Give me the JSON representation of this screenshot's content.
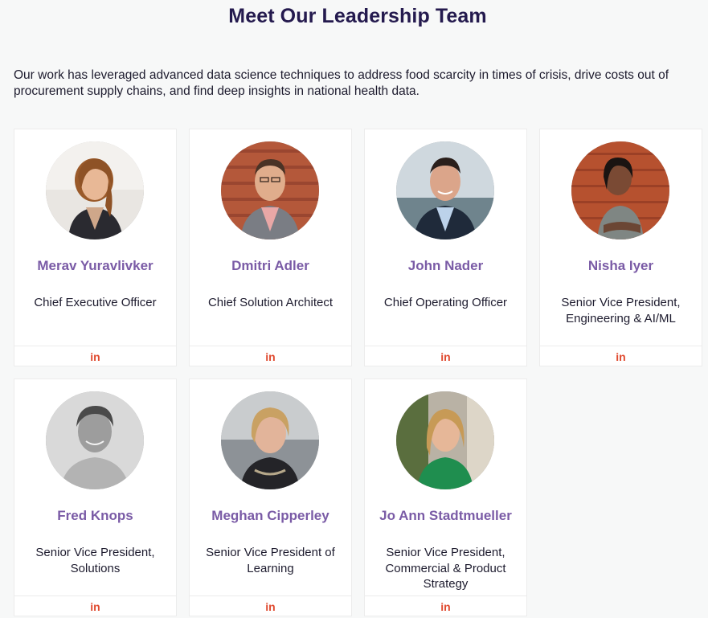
{
  "page": {
    "title": "Meet Our Leadership Team",
    "intro": "Our work has leveraged advanced data science techniques to address food scarcity in times of crisis, drive costs out of procurement supply chains, and find deep insights in national health data."
  },
  "team": [
    {
      "name": "Merav Yuravlivker",
      "role": "Chief Executive Officer",
      "social": "in"
    },
    {
      "name": "Dmitri Adler",
      "role": "Chief Solution Architect",
      "social": "in"
    },
    {
      "name": "John Nader",
      "role": "Chief Operating Officer",
      "social": "in"
    },
    {
      "name": "Nisha Iyer",
      "role": "Senior Vice President, Engineering & AI/ML",
      "social": "in"
    },
    {
      "name": "Fred Knops",
      "role": "Senior Vice President, Solutions",
      "social": "in"
    },
    {
      "name": "Meghan Cipperley",
      "role": "Senior Vice President of Learning",
      "social": "in"
    },
    {
      "name": "Jo Ann Stadtmueller",
      "role": "Senior Vice President, Commercial & Product Strategy",
      "social": "in"
    }
  ],
  "colors": {
    "title": "#241a4e",
    "name": "#7a5ba6",
    "linkedin": "#e04a2f"
  }
}
